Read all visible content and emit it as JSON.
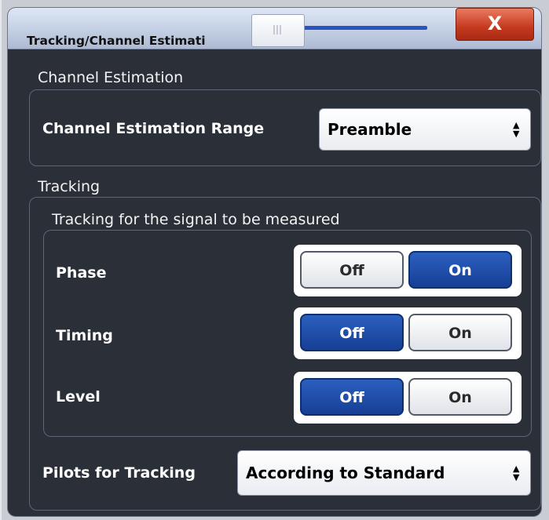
{
  "dialog": {
    "title": "Tracking/Channel Estimati",
    "close_label": "X"
  },
  "channel_estimation": {
    "section_label": "Channel Estimation",
    "range_label": "Channel Estimation Range",
    "range_value": "Preamble"
  },
  "tracking": {
    "section_label": "Tracking",
    "subgroup_label": "Tracking for the signal to be measured",
    "rows": [
      {
        "label": "Phase",
        "off_label": "Off",
        "on_label": "On",
        "selected": "On"
      },
      {
        "label": "Timing",
        "off_label": "Off",
        "on_label": "On",
        "selected": "Off"
      },
      {
        "label": "Level",
        "off_label": "Off",
        "on_label": "On",
        "selected": "Off"
      }
    ],
    "pilots_label": "Pilots for Tracking",
    "pilots_value": "According to Standard"
  },
  "icons": {
    "dropdown_arrows": "up-down-arrows-icon",
    "close": "close-icon",
    "slider_grip": "grip-icon"
  },
  "colors": {
    "dialog_bg": "#2b2f38",
    "active_toggle": "#1f4ea8",
    "close_button": "#c5391f",
    "slider_accent": "#2a53c2"
  }
}
